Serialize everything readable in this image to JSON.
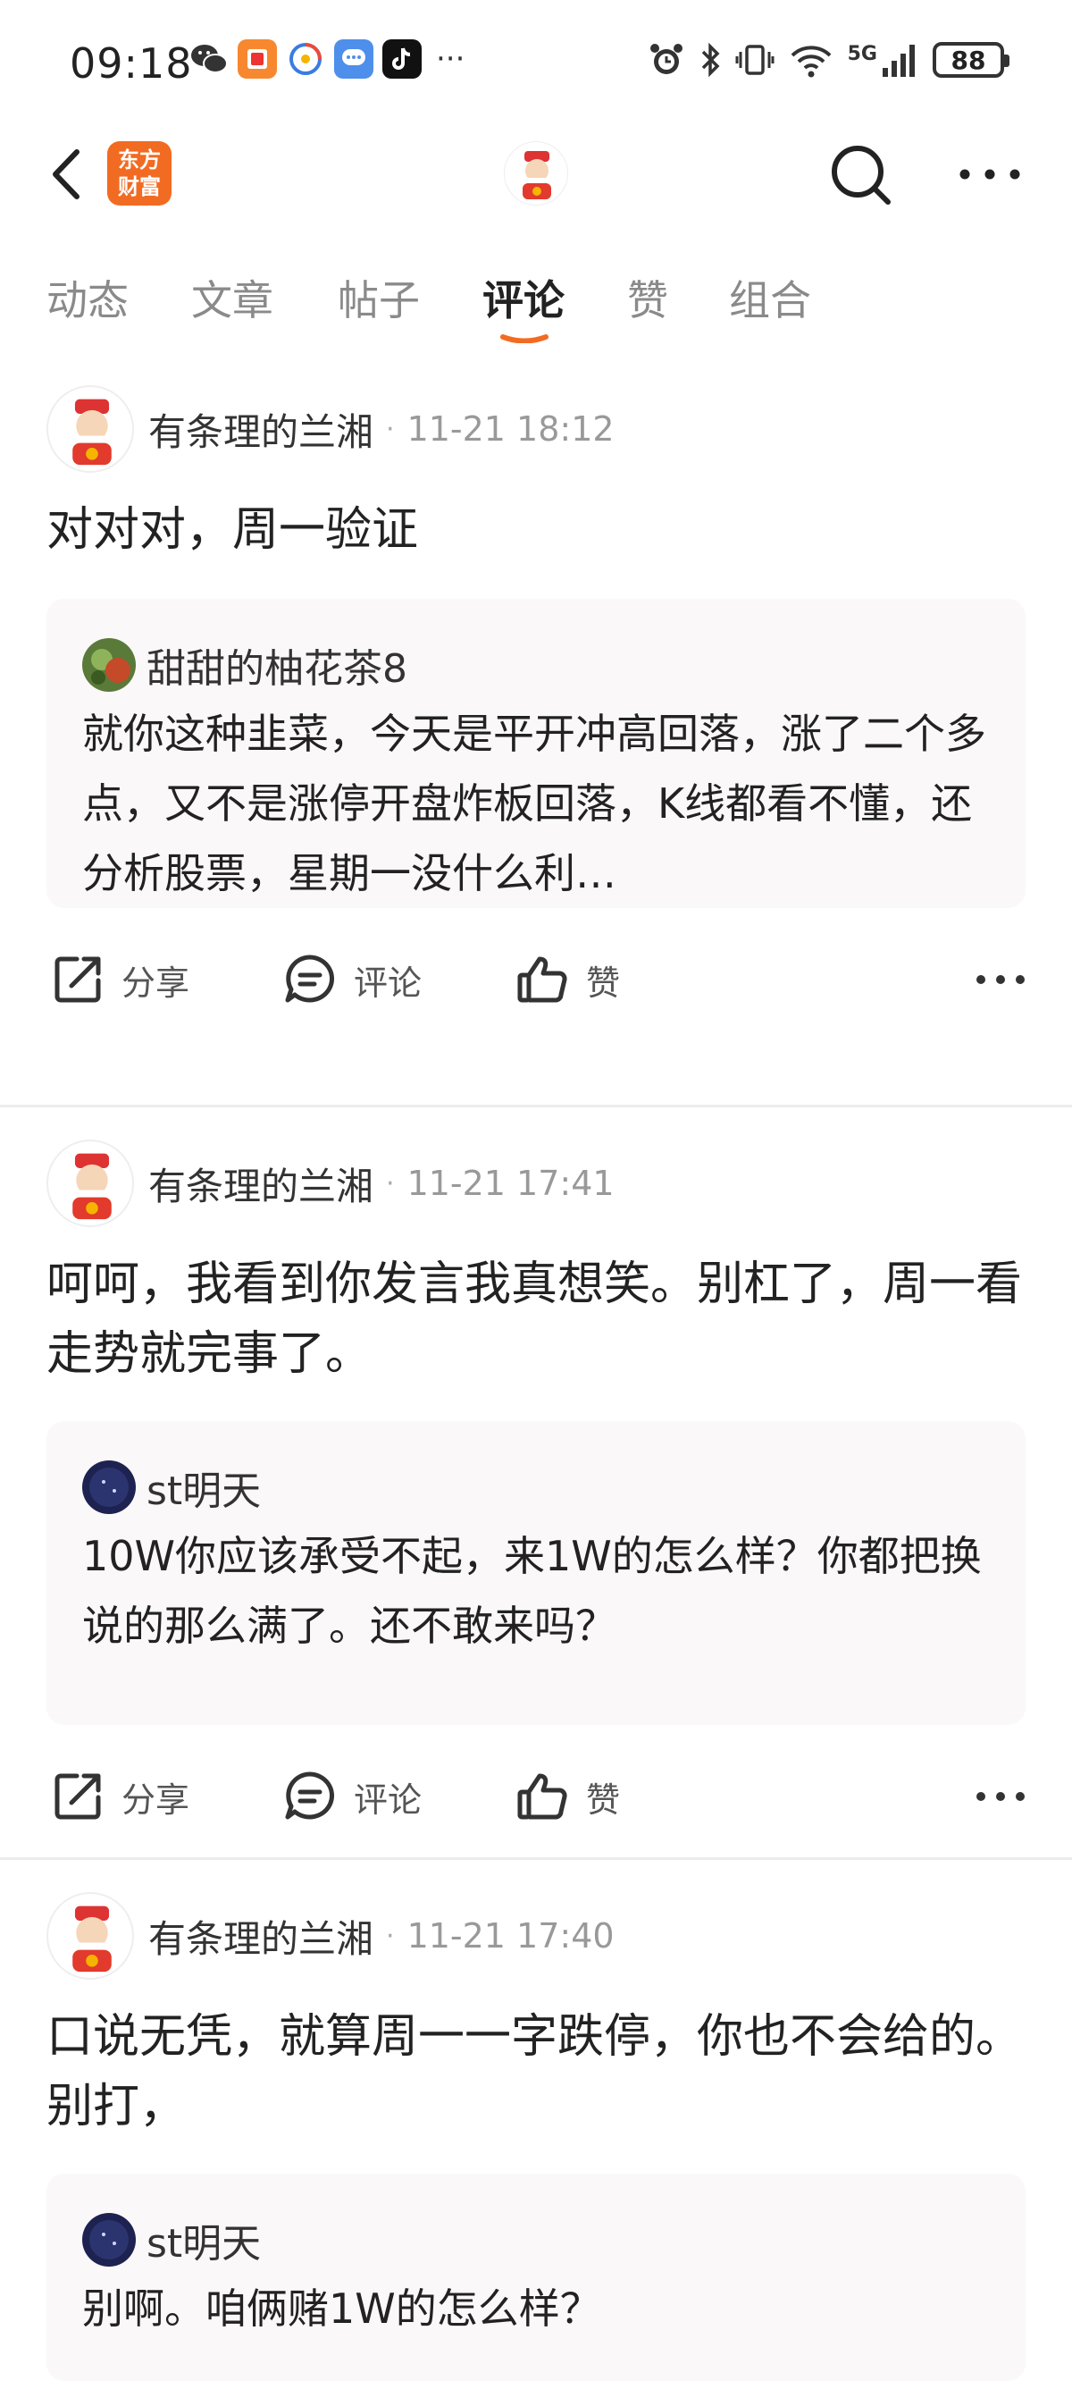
{
  "status_bar": {
    "time": "09:18",
    "network": "5G",
    "battery": "88",
    "icons": [
      "wechat-icon",
      "red-envelope-app-icon",
      "browser-app-icon",
      "message-app-icon",
      "tiktok-icon",
      "alarm-icon",
      "bluetooth-icon",
      "vibrate-icon",
      "wifi-icon",
      "signal-icon"
    ]
  },
  "header": {
    "brand_line1": "东方",
    "brand_line2": "财富",
    "brand_color": "#f26b22"
  },
  "tabs": [
    {
      "label": "动态",
      "active": false
    },
    {
      "label": "文章",
      "active": false
    },
    {
      "label": "帖子",
      "active": false
    },
    {
      "label": "评论",
      "active": true
    },
    {
      "label": "赞",
      "active": false
    },
    {
      "label": "组合",
      "active": false
    }
  ],
  "accent_color": "#f26b22",
  "actions": {
    "share": "分享",
    "comment": "评论",
    "like": "赞"
  },
  "posts": [
    {
      "author": "有条理的兰湘",
      "separator": "·",
      "time": "11-21 18:12",
      "text": "对对对，周一验证",
      "quote": {
        "author": "甜甜的柚花茶8",
        "text": "就你这种韭菜，今天是平开冲高回落，涨了二个多点，又不是涨停开盘炸板回落，K线都看不懂，还分析股票，星期一没什么利…"
      }
    },
    {
      "author": "有条理的兰湘",
      "separator": "·",
      "time": "11-21 17:41",
      "text": "呵呵，我看到你发言我真想笑。别杠了，周一看走势就完事了。",
      "quote": {
        "author": "st明天",
        "text": "10W你应该承受不起，来1W的怎么样？你都把换说的那么满了。还不敢来吗？"
      }
    },
    {
      "author": "有条理的兰湘",
      "separator": "·",
      "time": "11-21 17:40",
      "text": "口说无凭，就算周一一字跌停，你也不会给的。别打，",
      "quote": {
        "author": "st明天",
        "text": "别啊。咱俩赌1W的怎么样？"
      }
    }
  ]
}
